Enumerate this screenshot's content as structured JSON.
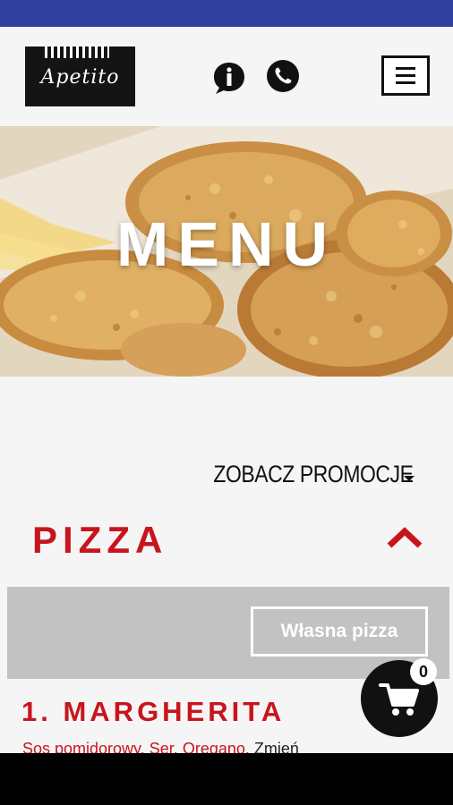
{
  "header": {
    "logo_text": "Apetito",
    "icons": [
      "info-icon",
      "phone-icon",
      "hamburger-menu-icon"
    ]
  },
  "hero": {
    "title": "MENU"
  },
  "promotions": {
    "label": "ZOBACZ PROMOCJE"
  },
  "category": {
    "title": "PIZZA"
  },
  "custom_pizza": {
    "label": "Własna pizza"
  },
  "product": {
    "title": "1. MARGHERITA",
    "ingredients": [
      "Sos pomidorowy",
      "Ser",
      "Oregano"
    ],
    "separator": ",",
    "change_label": "Zmień"
  },
  "cart": {
    "count": "0"
  },
  "colors": {
    "status_bar": "#2f3f9e",
    "accent_red": "#c8151d",
    "panel_gray": "#c2c2c2",
    "fab_black": "#111111"
  }
}
